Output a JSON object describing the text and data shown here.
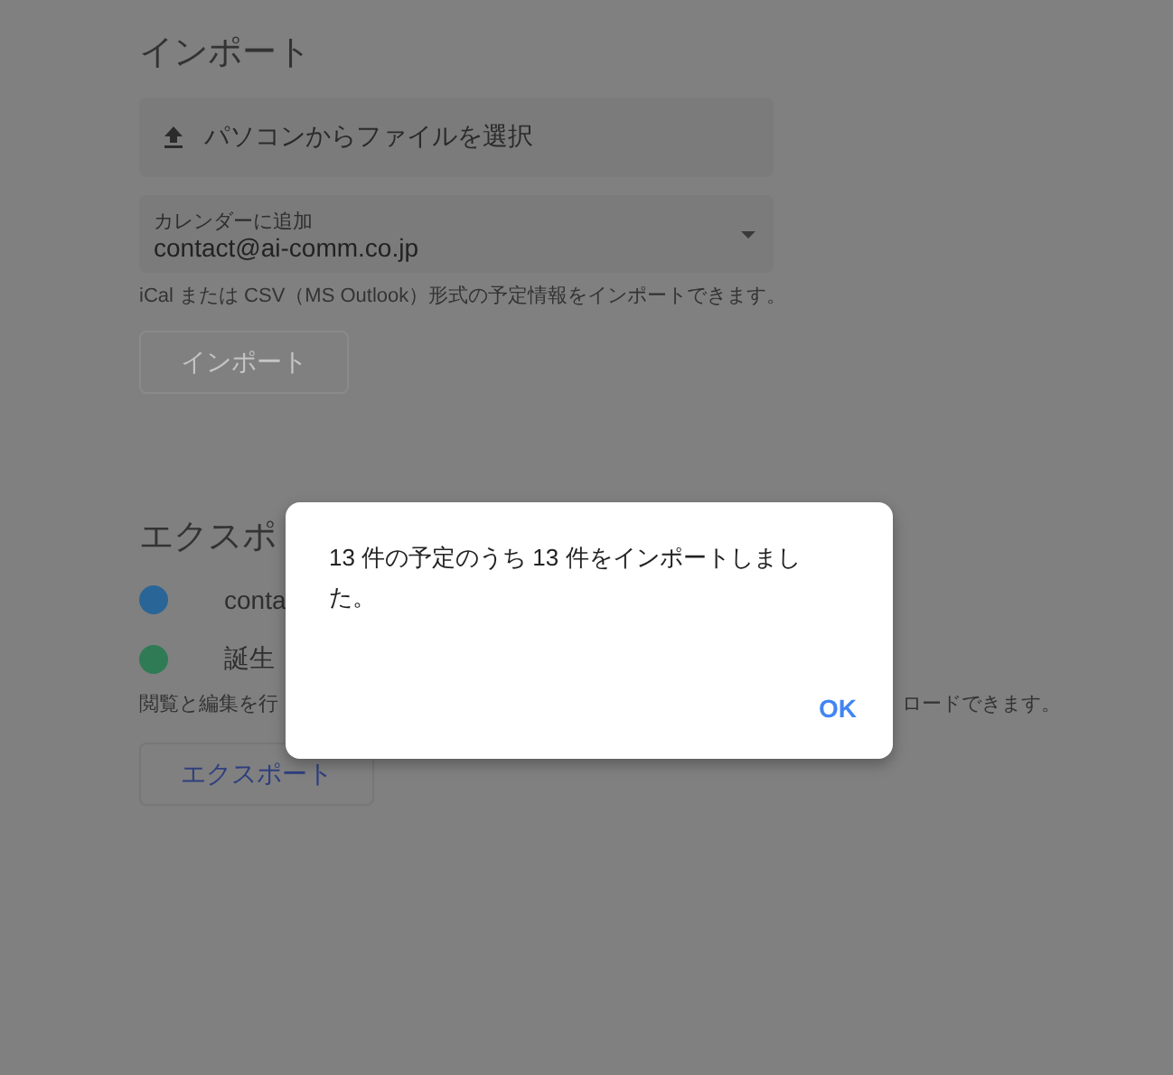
{
  "import": {
    "title": "インポート",
    "file_button": "パソコンからファイルを選択",
    "calendar_select": {
      "label": "カレンダーに追加",
      "value": "contact@ai-comm.co.jp"
    },
    "help": "iCal または CSV（MS Outlook）形式の予定情報をインポートできます。",
    "import_button": {
      "label": "インポート",
      "disabled": true
    }
  },
  "export": {
    "title": "エクスポ",
    "calendars": [
      {
        "name": "conta",
        "color": "#2a6597"
      },
      {
        "name": "誕生",
        "color": "#2f7b55"
      }
    ],
    "help_left": "閲覧と編集を行",
    "help_right": "ロードできます。",
    "export_button": "エクスポート"
  },
  "dialog": {
    "message": "13 件の予定のうち 13 件をインポートしました。",
    "ok": "OK"
  }
}
